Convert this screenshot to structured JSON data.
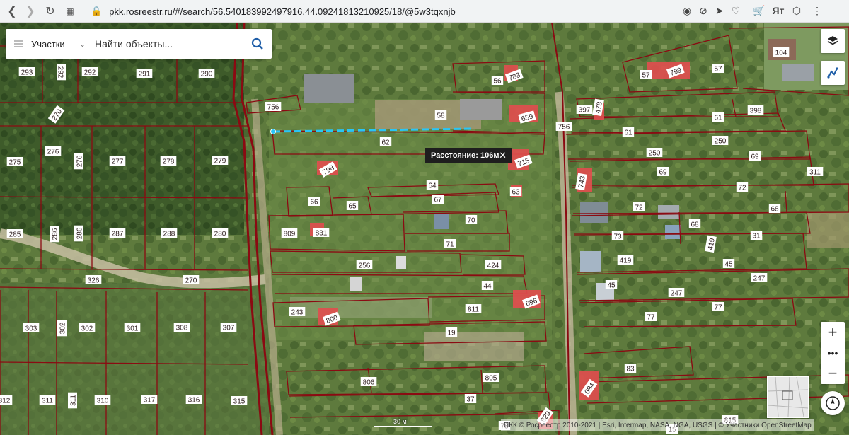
{
  "browser": {
    "url": "pkk.rosreestr.ru/#/search/56.540183992497916,44.09241813210925/18/@5w3tqxnjb",
    "icons": [
      "back-icon",
      "forward-icon",
      "reload-icon",
      "tabs-icon",
      "lock-icon",
      "camera-icon",
      "block-icon",
      "send-icon",
      "heart-icon",
      "cart-icon",
      "translate-icon",
      "box-icon",
      "menu-dots-icon"
    ]
  },
  "search": {
    "category": "Участки",
    "placeholder": "Найти объекты..."
  },
  "measurement": {
    "label": "Расстояние: 106м"
  },
  "scale": {
    "label": "30 м"
  },
  "attribution": {
    "text": "ПКК © Росреестр 2010-2021 | Esri, Intermap, NASA, NGA, USGS | © Участники OpenStreetMap"
  },
  "colors": {
    "parcel_border": "#8b0a12",
    "building": "#e85a5a",
    "measure_line": "#29c5f6",
    "imagery_dark": "#3c4f29",
    "imagery_light": "#7d9a55",
    "road": "#c2b89b"
  },
  "map": {
    "parcels": [
      {
        "id": "293"
      },
      {
        "id": "292"
      },
      {
        "id": "292b",
        "text": "292"
      },
      {
        "id": "291"
      },
      {
        "id": "290"
      },
      {
        "id": "270a",
        "text": "270"
      },
      {
        "id": "275"
      },
      {
        "id": "276a",
        "text": "276"
      },
      {
        "id": "276b",
        "text": "276"
      },
      {
        "id": "277"
      },
      {
        "id": "278"
      },
      {
        "id": "279"
      },
      {
        "id": "285"
      },
      {
        "id": "286a",
        "text": "286"
      },
      {
        "id": "286b",
        "text": "286"
      },
      {
        "id": "287"
      },
      {
        "id": "288"
      },
      {
        "id": "280"
      },
      {
        "id": "326"
      },
      {
        "id": "270b",
        "text": "270"
      },
      {
        "id": "303"
      },
      {
        "id": "302a",
        "text": "302"
      },
      {
        "id": "302b",
        "text": "302"
      },
      {
        "id": "301"
      },
      {
        "id": "308"
      },
      {
        "id": "307"
      },
      {
        "id": "312"
      },
      {
        "id": "311a",
        "text": "311"
      },
      {
        "id": "311b",
        "text": "311"
      },
      {
        "id": "310"
      },
      {
        "id": "317"
      },
      {
        "id": "316"
      },
      {
        "id": "315"
      },
      {
        "id": "756a",
        "text": "756"
      },
      {
        "id": "58"
      },
      {
        "id": "62"
      },
      {
        "id": "798"
      },
      {
        "id": "715"
      },
      {
        "id": "56"
      },
      {
        "id": "783"
      },
      {
        "id": "659"
      },
      {
        "id": "64"
      },
      {
        "id": "67"
      },
      {
        "id": "63"
      },
      {
        "id": "66"
      },
      {
        "id": "65"
      },
      {
        "id": "809"
      },
      {
        "id": "831"
      },
      {
        "id": "70"
      },
      {
        "id": "71"
      },
      {
        "id": "256"
      },
      {
        "id": "424"
      },
      {
        "id": "44"
      },
      {
        "id": "243"
      },
      {
        "id": "800"
      },
      {
        "id": "811"
      },
      {
        "id": "696"
      },
      {
        "id": "19"
      },
      {
        "id": "806"
      },
      {
        "id": "805"
      },
      {
        "id": "37"
      },
      {
        "id": "829"
      },
      {
        "id": "78"
      },
      {
        "id": "57a",
        "text": "57"
      },
      {
        "id": "799"
      },
      {
        "id": "57b",
        "text": "57"
      },
      {
        "id": "104"
      },
      {
        "id": "397"
      },
      {
        "id": "478"
      },
      {
        "id": "61a",
        "text": "61"
      },
      {
        "id": "398"
      },
      {
        "id": "756b",
        "text": "756"
      },
      {
        "id": "61b",
        "text": "61"
      },
      {
        "id": "250a",
        "text": "250"
      },
      {
        "id": "250b",
        "text": "250"
      },
      {
        "id": "69a",
        "text": "69"
      },
      {
        "id": "743"
      },
      {
        "id": "69b",
        "text": "69"
      },
      {
        "id": "311c",
        "text": "311"
      },
      {
        "id": "72a",
        "text": "72"
      },
      {
        "id": "72b",
        "text": "72"
      },
      {
        "id": "68a",
        "text": "68"
      },
      {
        "id": "68b",
        "text": "68"
      },
      {
        "id": "73"
      },
      {
        "id": "31"
      },
      {
        "id": "419a",
        "text": "419"
      },
      {
        "id": "419b",
        "text": "419"
      },
      {
        "id": "45a",
        "text": "45"
      },
      {
        "id": "45b",
        "text": "45"
      },
      {
        "id": "247a",
        "text": "247"
      },
      {
        "id": "247b",
        "text": "247"
      },
      {
        "id": "77a",
        "text": "77"
      },
      {
        "id": "77b",
        "text": "77"
      },
      {
        "id": "83"
      },
      {
        "id": "694"
      },
      {
        "id": "815"
      },
      {
        "id": "15"
      }
    ]
  }
}
